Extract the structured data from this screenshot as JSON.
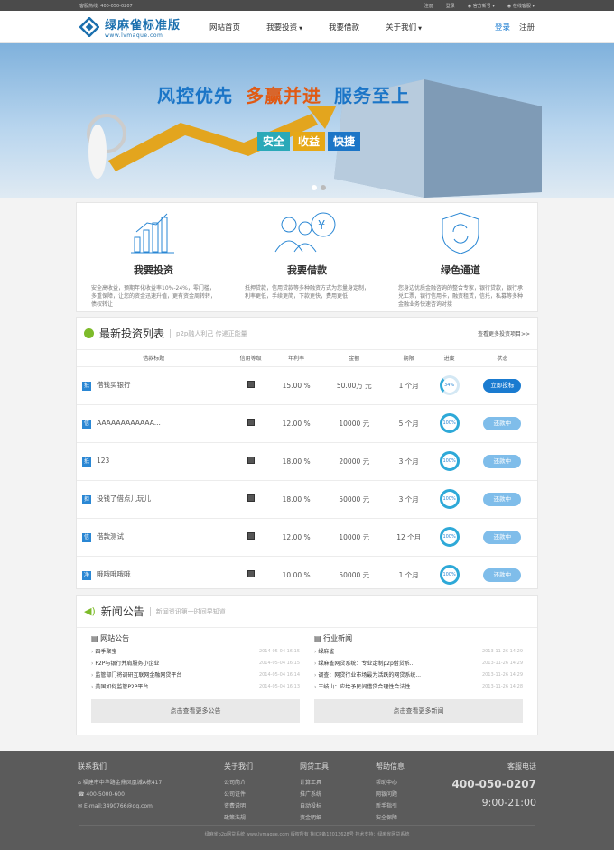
{
  "topbar": {
    "hotline": "客服热线: 400-050-0207",
    "links": [
      "注册",
      "登录",
      "官方新号",
      "在线客服"
    ]
  },
  "logo": {
    "name": "绿麻雀标准版",
    "url": "www.lvmaque.com"
  },
  "nav": {
    "items": [
      "网站首页",
      "我要投资",
      "我要借款",
      "关于我们"
    ],
    "login": "登录",
    "register": "注册"
  },
  "banner": {
    "s1": "风控优先",
    "s2": "多赢并进",
    "s3": "服务至上",
    "tags": [
      "安全",
      "收益",
      "快捷"
    ]
  },
  "features": [
    {
      "title": "我要投资",
      "desc": "安全高收益，预期年化收益率10%-24%，零门槛，多重保障，让您的资金迅速升值，更有资金周转转，债权转让"
    },
    {
      "title": "我要借款",
      "desc": "抵押贷款，信用贷款等多种融资方式为您量身定制，利率更低，手续更简，下款更快，费用更低"
    },
    {
      "title": "绿色通道",
      "desc": "您身边优质金融咨询的整合专家，银行贷款，银行承兑汇票，银行信用卡，融资租赁，信托，私募等多种金融业务快速咨询对接"
    }
  ],
  "invest": {
    "title": "最新投资列表",
    "subtitle": "p2p融人利己 传递正能量",
    "more": "查看更多投资项目>>",
    "headers": [
      "借款标题",
      "信用等级",
      "年利率",
      "金额",
      "期限",
      "进度",
      "状态"
    ],
    "rows": [
      {
        "icon": "抵",
        "name": "借钱买银行",
        "rate": "15.00 %",
        "amount": "50.00万 元",
        "term": "1 个月",
        "progress": "34%",
        "status": "立即投标"
      },
      {
        "icon": "信",
        "name": "AAAAAAAAAAAA...",
        "rate": "12.00 %",
        "amount": "10000 元",
        "term": "5 个月",
        "progress": "100%",
        "status": "还款中"
      },
      {
        "icon": "抵",
        "name": "123",
        "rate": "18.00 %",
        "amount": "20000 元",
        "term": "3 个月",
        "progress": "100%",
        "status": "还款中"
      },
      {
        "icon": "担",
        "name": "没钱了借点儿玩儿",
        "rate": "18.00 %",
        "amount": "50000 元",
        "term": "3 个月",
        "progress": "100%",
        "status": "还款中"
      },
      {
        "icon": "信",
        "name": "借款测试",
        "rate": "12.00 %",
        "amount": "10000 元",
        "term": "12 个月",
        "progress": "100%",
        "status": "还款中"
      },
      {
        "icon": "净",
        "name": "哦哦哦哦哦",
        "rate": "10.00 %",
        "amount": "50000 元",
        "term": "1 个月",
        "progress": "100%",
        "status": "还款中"
      }
    ]
  },
  "news": {
    "title": "新闻公告",
    "subtitle": "新闻资讯第一时间早知道",
    "left": {
      "title": "网站公告",
      "more": "点击查看更多公告",
      "items": [
        {
          "t": "四季聚宝",
          "d": "2014-05-04 16:15"
        },
        {
          "t": "P2P与银行并肩服务小企业",
          "d": "2014-05-04 16:15"
        },
        {
          "t": "监管部门将调研互联网金融网贷平台",
          "d": "2014-05-04 16:14"
        },
        {
          "t": "美国如何监管P2P平台",
          "d": "2014-05-04 16:13"
        }
      ]
    },
    "right": {
      "title": "行业新闻",
      "more": "点击查看更多新闻",
      "items": [
        {
          "t": "绿麻雀",
          "d": "2013-11-26 14:29"
        },
        {
          "t": "绿麻雀网贷系统：专业定制p2p借贷系...",
          "d": "2013-11-26 14:29"
        },
        {
          "t": "调查：网贷行业市场最为活跃的网贷系统...",
          "d": "2013-11-26 14:29"
        },
        {
          "t": "王岐山：应给予民间借贷合理性合法性",
          "d": "2013-11-26 14:28"
        }
      ]
    }
  },
  "footer": {
    "contact": {
      "title": "联系我们",
      "addr": "福建市中华路金鼎凤凰城A栋417",
      "phone": "400-5000-600",
      "email": "E-mail:3490766@qq.com"
    },
    "cols": [
      {
        "title": "关于我们",
        "items": [
          "公司简介",
          "公司证件",
          "资费说明",
          "政策法规"
        ]
      },
      {
        "title": "网贷工具",
        "items": [
          "计算工具",
          "推广系统",
          "自动投标",
          "资金明细"
        ]
      },
      {
        "title": "帮助信息",
        "items": [
          "帮助中心",
          "网银问题",
          "新手指引",
          "安全保障"
        ]
      }
    ],
    "service": {
      "title": "客服电话",
      "phone": "400-050-0207",
      "hours": "9:00-21:00"
    },
    "copyright": "绿麻雀p2p网贷系统 www.lvmaque.com 版权所有 鲁ICP备12013628号 技术支持：绿麻雀网贷系统"
  }
}
